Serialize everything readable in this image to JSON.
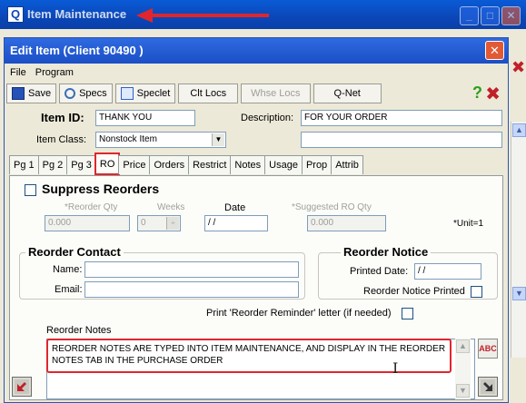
{
  "outer_window": {
    "title": "Item Maintenance",
    "app_icon": "Q"
  },
  "dialog": {
    "title": "Edit Item (Client 90490 )"
  },
  "menu": [
    "File",
    "Program"
  ],
  "toolbar": {
    "save": "Save",
    "specs": "Specs",
    "speclet": "Speclet",
    "clt_locs": "Clt Locs",
    "whse_locs": "Whse Locs",
    "qnet": "Q-Net",
    "help": "?"
  },
  "item": {
    "id_label": "Item ID:",
    "id_value": "THANK YOU",
    "description_label": "Description:",
    "description_value": "FOR YOUR ORDER",
    "description_value2": "",
    "class_label": "Item Class:",
    "class_value": "Nonstock Item"
  },
  "tabs": [
    "Pg 1",
    "Pg 2",
    "Pg 3",
    "RO",
    "Price",
    "Orders",
    "Restrict",
    "Notes",
    "Usage",
    "Prop",
    "Attrib"
  ],
  "active_tab": "RO",
  "ro": {
    "suppress_label": "Suppress Reorders",
    "suppress_checked": false,
    "reorder_qty_label": "*Reorder Qty",
    "reorder_qty_value": "0.000",
    "weeks_label": "Weeks",
    "weeks_value": "0",
    "date_label": "Date",
    "date_value": "/ /",
    "suggested_label": "*Suggested RO Qty",
    "suggested_value": "0.000",
    "unit_note": "*Unit=1",
    "contact_title": "Reorder Contact",
    "name_label": "Name:",
    "name_value": "",
    "email_label": "Email:",
    "email_value": "",
    "notice_title": "Reorder Notice",
    "printed_date_label": "Printed Date:",
    "printed_date_value": "/ /",
    "notice_printed_label": "Reorder Notice Printed",
    "notice_printed_checked": false,
    "print_letter_label": "Print 'Reorder Reminder' letter (if needed)",
    "print_letter_checked": false,
    "notes_label": "Reorder Notes",
    "notes_text": "REORDER NOTES ARE TYPED INTO ITEM MAINTENANCE, AND DISPLAY IN THE REORDER NOTES TAB IN THE PURCHASE ORDER",
    "spell_label": "ABC"
  },
  "colors": {
    "highlight": "#e0262c",
    "titlebar": "#1b4fc6",
    "help": "#2f9e1d",
    "close": "#c0202a"
  }
}
